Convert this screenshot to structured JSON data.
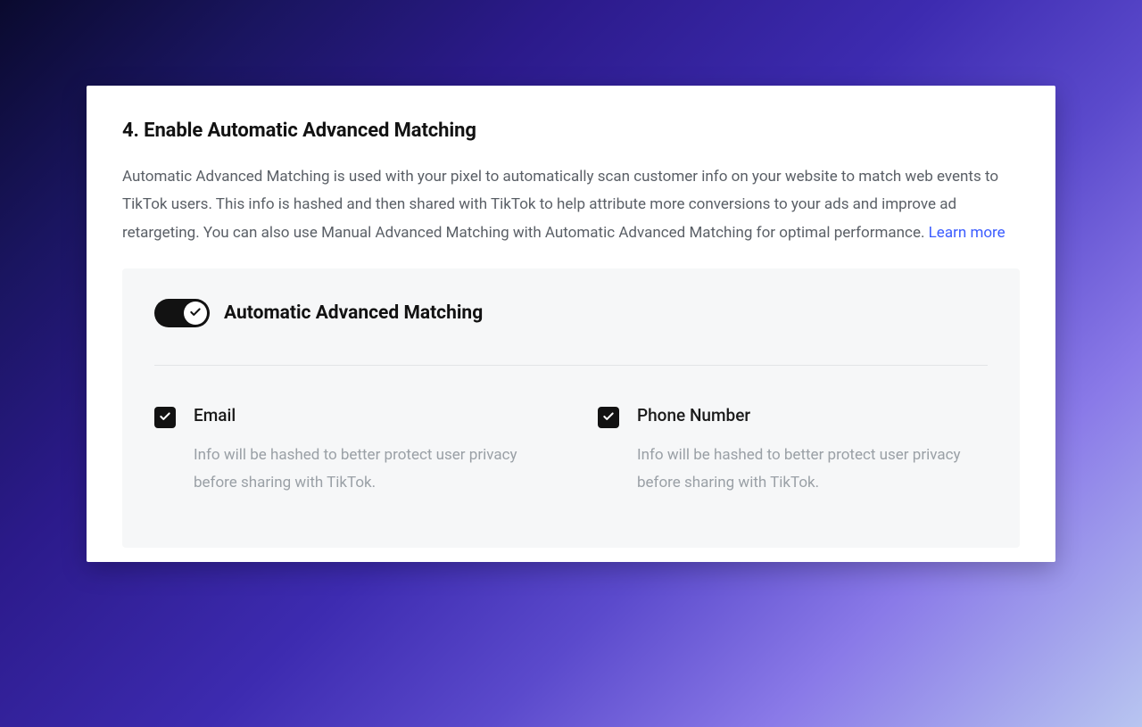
{
  "section": {
    "title": "4. Enable Automatic Advanced Matching",
    "description_text": "Automatic Advanced Matching is used with your pixel to automatically scan customer info on your website to match web events to TikTok users. This info is hashed and then shared with TikTok to help attribute more conversions to your ads and improve ad retargeting. You can also use Manual Advanced Matching with Automatic Advanced Matching for optimal performance. ",
    "learn_more_label": "Learn more"
  },
  "panel": {
    "toggle": {
      "label": "Automatic Advanced Matching",
      "enabled": true
    },
    "options": [
      {
        "key": "email",
        "title": "Email",
        "description": "Info will be hashed to better protect user privacy before sharing with TikTok.",
        "checked": true
      },
      {
        "key": "phone",
        "title": "Phone Number",
        "description": "Info will be hashed to better protect user privacy before sharing with TikTok.",
        "checked": true
      }
    ]
  }
}
